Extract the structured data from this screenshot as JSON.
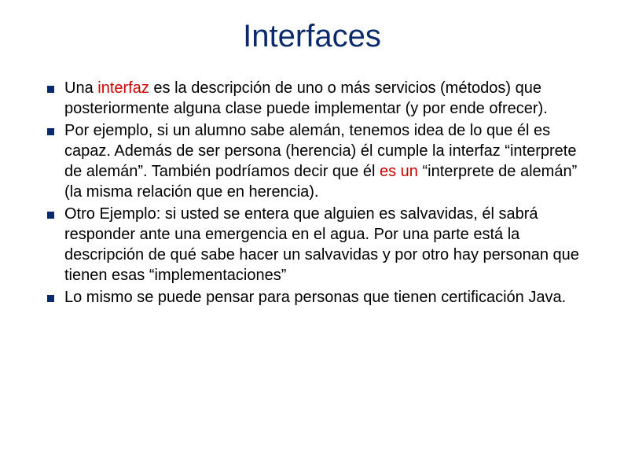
{
  "title": "Interfaces",
  "bullets": [
    {
      "pre": "Una ",
      "hl": "interfaz",
      "post": " es la descripción de uno o más servicios (métodos) que posteriormente alguna clase puede implementar (y por ende ofrecer)."
    },
    {
      "pre": "Por ejemplo, si un alumno sabe alemán, tenemos idea de lo que él es capaz. Además de ser persona (herencia) él cumple la interfaz “interprete de alemán”. También podríamos decir que él ",
      "hl": "es un",
      "post": " “interprete de alemán” (la misma relación que en herencia)."
    },
    {
      "pre": "Otro Ejemplo: si usted se entera que alguien es salvavidas, él sabrá responder ante una emergencia en el agua. Por una parte está la descripción de qué sabe hacer un salvavidas y por otro hay personan que tienen esas “implementaciones”",
      "hl": "",
      "post": ""
    },
    {
      "pre": "Lo mismo se puede pensar para personas que tienen certificación Java.",
      "hl": "",
      "post": ""
    }
  ]
}
